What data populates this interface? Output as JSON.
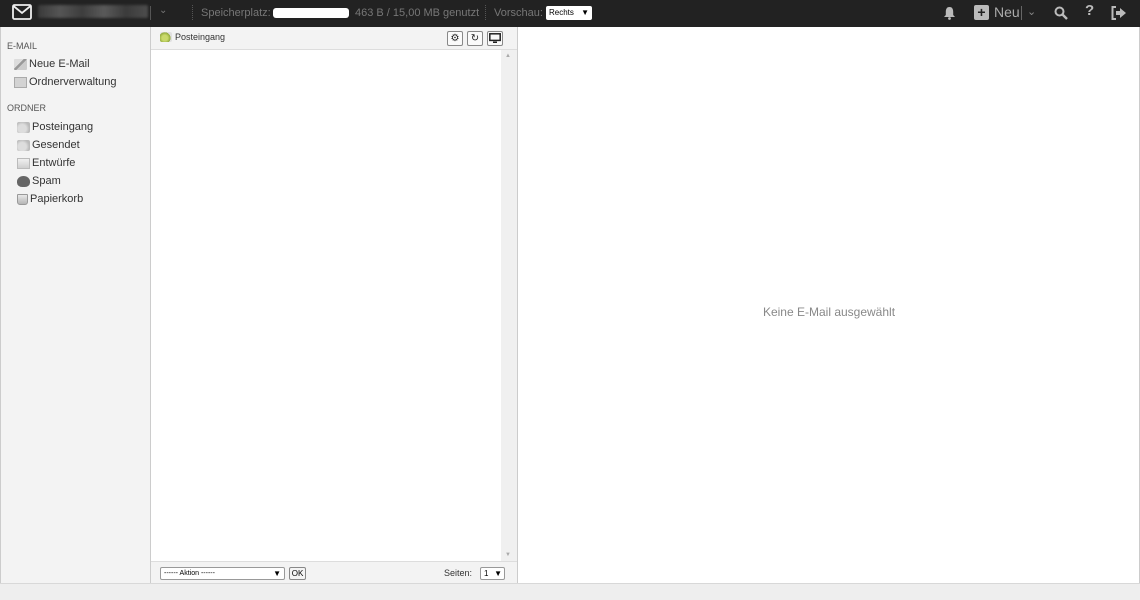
{
  "topbar": {
    "mail_icon": "envelope-icon",
    "storage_label": "Speicherplatz:",
    "storage_used_fraction": 0.0,
    "storage_text": "463 B / 15,00 MB genutzt",
    "preview_label": "Vorschau:",
    "preview_value": "Rechts",
    "icons": [
      "bell-icon",
      "plus-icon",
      "search-icon",
      "help-icon",
      "logout-icon"
    ],
    "new_label": "Neu"
  },
  "sidebar": {
    "email_heading": "E-MAIL",
    "email_items": [
      {
        "label": "Neue E-Mail",
        "icon": "compose-icon"
      },
      {
        "label": "Ordnerverwaltung",
        "icon": "folder-manage-icon"
      }
    ],
    "folder_heading": "ORDNER",
    "folders": [
      {
        "label": "Posteingang",
        "icon": "inbox-icon"
      },
      {
        "label": "Gesendet",
        "icon": "sent-icon"
      },
      {
        "label": "Entwürfe",
        "icon": "drafts-icon"
      },
      {
        "label": "Spam",
        "icon": "spam-icon"
      },
      {
        "label": "Papierkorb",
        "icon": "trash-icon"
      }
    ]
  },
  "list": {
    "title": "Posteingang",
    "header_buttons": [
      "settings-icon",
      "refresh-icon",
      "monitor-icon"
    ],
    "action_select": "------ Aktion ------",
    "ok_label": "OK",
    "pages_label": "Seiten:",
    "pages_value": "1"
  },
  "preview": {
    "empty_text": "Keine E-Mail ausgewählt"
  }
}
